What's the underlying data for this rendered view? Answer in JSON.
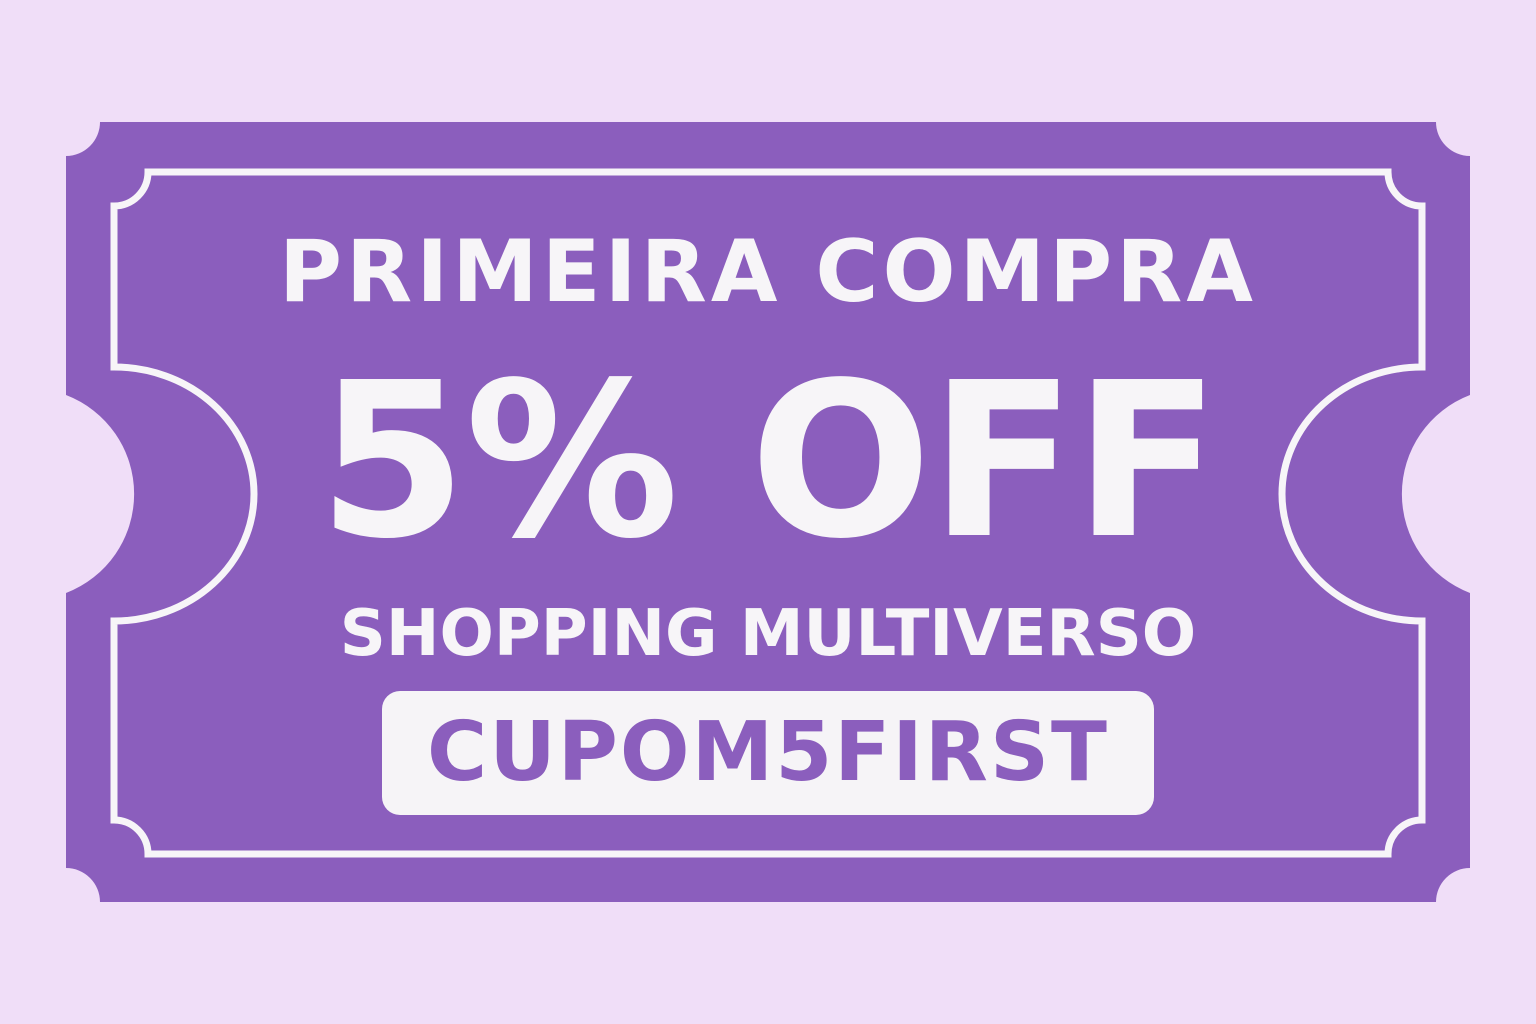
{
  "coupon": {
    "headline": "PRIMEIRA COMPRA",
    "discount": "5% OFF",
    "store": "SHOPPING MULTIVERSO",
    "code": "CUPOM5FIRST"
  },
  "colors": {
    "background": "#f0def8",
    "ticket": "#8b5ebd",
    "text": "#f7f5f8",
    "code_text": "#8b5ebd"
  }
}
